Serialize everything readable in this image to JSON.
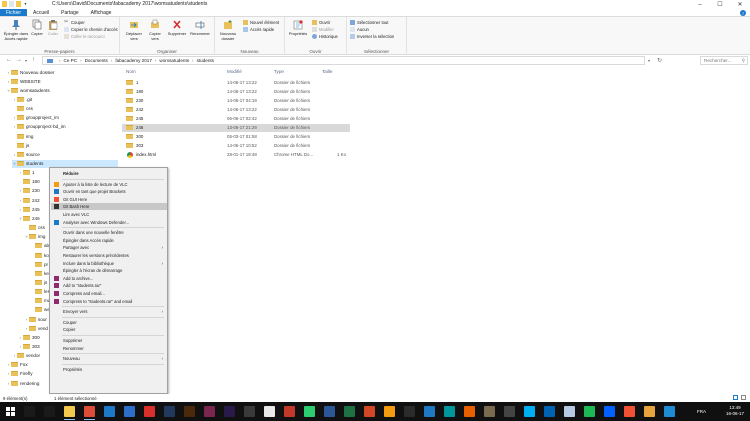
{
  "window": {
    "title": "C:\\Users\\David\\Documents\\fabacademy 2017\\womsatudents\\students",
    "controls": [
      "–",
      "☐",
      "✕"
    ]
  },
  "ribbon": {
    "tabs": [
      "Fichier",
      "Accueil",
      "Partage",
      "Affichage"
    ],
    "groups": {
      "clipboard": {
        "label": "Presse-papiers",
        "pin": "Épingler dans Accès rapide",
        "copy": "Copier",
        "paste": "Coller",
        "cut": "Couper",
        "copy_path": "Copier le chemin d'accès",
        "paste_shortcut": "Coller le raccourci"
      },
      "organize": {
        "label": "Organiser",
        "move": "Déplacer vers",
        "copy_to": "Copier vers",
        "delete": "Supprimer",
        "rename": "Renommer"
      },
      "new": {
        "label": "Nouveau",
        "new_folder": "Nouveau dossier",
        "new_item": "Nouvel élément",
        "easy_access": "Accès rapide"
      },
      "open": {
        "label": "Ouvrir",
        "properties": "Propriétés",
        "open": "Ouvrir",
        "edit": "Modifier",
        "history": "Historique"
      },
      "select": {
        "label": "Sélectionner",
        "select_all": "Sélectionner tout",
        "select_none": "Aucun",
        "invert": "Inverser la sélection"
      }
    }
  },
  "address": {
    "crumbs": [
      "Ce PC",
      "Documents",
      "fabacademy 2017",
      "womsatudents",
      "students"
    ],
    "search_placeholder": "Rechercher..."
  },
  "nav": [
    {
      "label": "Nouveau dossier",
      "depth": 1,
      "chev": ">"
    },
    {
      "label": "WEBSITE",
      "depth": 1,
      "chev": ">"
    },
    {
      "label": "womsatudents",
      "depth": 1,
      "chev": "v"
    },
    {
      "label": ".git",
      "depth": 2,
      "chev": ">"
    },
    {
      "label": "css",
      "depth": 2,
      "chev": ""
    },
    {
      "label": "groupproject_im",
      "depth": 2,
      "chev": ">"
    },
    {
      "label": "groupproject-bd_im",
      "depth": 2,
      "chev": ">"
    },
    {
      "label": "img",
      "depth": 2,
      "chev": ""
    },
    {
      "label": "js",
      "depth": 2,
      "chev": ""
    },
    {
      "label": "source",
      "depth": 2,
      "chev": ">"
    },
    {
      "label": "students",
      "depth": 2,
      "chev": "v",
      "selected": true
    },
    {
      "label": "1",
      "depth": 3,
      "chev": ">"
    },
    {
      "label": "180",
      "depth": 3,
      "chev": ""
    },
    {
      "label": "230",
      "depth": 3,
      "chev": ">"
    },
    {
      "label": "242",
      "depth": 3,
      "chev": ">"
    },
    {
      "label": "245",
      "depth": 3,
      "chev": ">"
    },
    {
      "label": "246",
      "depth": 3,
      "chev": "v"
    },
    {
      "label": "css",
      "depth": 4,
      "chev": ""
    },
    {
      "label": "img",
      "depth": 4,
      "chev": "v"
    },
    {
      "label": "ab",
      "depth": 5,
      "chev": ""
    },
    {
      "label": "ko",
      "depth": 5,
      "chev": ""
    },
    {
      "label": "pr",
      "depth": 5,
      "chev": ""
    },
    {
      "label": "ke",
      "depth": 5,
      "chev": ""
    },
    {
      "label": "js",
      "depth": 5,
      "chev": ""
    },
    {
      "label": "les",
      "depth": 5,
      "chev": ""
    },
    {
      "label": "mai",
      "depth": 5,
      "chev": ""
    },
    {
      "label": "wee",
      "depth": 5,
      "chev": ""
    },
    {
      "label": "sour",
      "depth": 4,
      "chev": ">"
    },
    {
      "label": "vend",
      "depth": 4,
      "chev": ">"
    },
    {
      "label": "300",
      "depth": 3,
      "chev": ">"
    },
    {
      "label": "303",
      "depth": 3,
      "chev": ">"
    },
    {
      "label": "vendor",
      "depth": 2,
      "chev": ">"
    },
    {
      "label": "Fox",
      "depth": 1,
      "chev": ">"
    },
    {
      "label": "Firefly",
      "depth": 1,
      "chev": ">"
    },
    {
      "label": "rendering",
      "depth": 1,
      "chev": ">"
    }
  ],
  "columns": {
    "name": "Nom",
    "modified": "Modifié",
    "type": "Type",
    "size": "Taille"
  },
  "files": [
    {
      "name": "1",
      "modified": "14-06-17 13:22",
      "type": "Dossier de fichiers",
      "size": "",
      "kind": "folder"
    },
    {
      "name": "180",
      "modified": "14-06-17 13:22",
      "type": "Dossier de fichiers",
      "size": "",
      "kind": "folder"
    },
    {
      "name": "230",
      "modified": "14-06-17 04:19",
      "type": "Dossier de fichiers",
      "size": "",
      "kind": "folder"
    },
    {
      "name": "242",
      "modified": "14-06-17 13:22",
      "type": "Dossier de fichiers",
      "size": "",
      "kind": "folder"
    },
    {
      "name": "245",
      "modified": "06-06-17 02:42",
      "type": "Dossier de fichiers",
      "size": "",
      "kind": "folder"
    },
    {
      "name": "246",
      "modified": "13-06-17 21:29",
      "type": "Dossier de fichiers",
      "size": "",
      "kind": "folder",
      "highlight": true
    },
    {
      "name": "300",
      "modified": "05-03-17 01:58",
      "type": "Dossier de fichiers",
      "size": "",
      "kind": "folder"
    },
    {
      "name": "303",
      "modified": "14-06-17 10:52",
      "type": "Dossier de fichiers",
      "size": "",
      "kind": "folder"
    },
    {
      "name": "index.html",
      "modified": "28-01-17 18:48",
      "type": "Chrome HTML Do...",
      "size": "1 Ko",
      "kind": "html"
    }
  ],
  "context_menu": [
    {
      "label": "Réduire",
      "bold": true
    },
    {
      "sep": true
    },
    {
      "label": "Ajouter à la liste de lecture de VLC",
      "icon": "vlc-icon"
    },
    {
      "label": "Ouvrir en tant que projet Brackets",
      "icon": "brackets-icon"
    },
    {
      "label": "Git GUI Here",
      "icon": "git-gui-icon"
    },
    {
      "label": "Git Bash Here",
      "icon": "git-bash-icon",
      "hover": true
    },
    {
      "label": "Lire avec VLC",
      "icon": ""
    },
    {
      "label": "Analyser avec Windows Defender...",
      "icon": "defender-icon"
    },
    {
      "sep": true
    },
    {
      "label": "Ouvrir dans une nouvelle fenêtre"
    },
    {
      "label": "Épingler dans Accès rapide"
    },
    {
      "label": "Partager avec",
      "sub": true
    },
    {
      "label": "Restaurer les versions précédentes"
    },
    {
      "label": "Inclure dans la bibliothèque",
      "sub": true
    },
    {
      "label": "Épingler à l'écran de démarrage"
    },
    {
      "label": "Add to archive...",
      "icon": "winrar-icon"
    },
    {
      "label": "Add to \"students.rar\"",
      "icon": "winrar-icon"
    },
    {
      "label": "Compress and email...",
      "icon": "winrar-icon"
    },
    {
      "label": "Compress to \"students.rar\" and email",
      "icon": "winrar-icon"
    },
    {
      "sep": true
    },
    {
      "label": "Envoyer vers",
      "sub": true
    },
    {
      "sep": true
    },
    {
      "label": "Couper"
    },
    {
      "label": "Copier"
    },
    {
      "sep": true
    },
    {
      "label": "Supprimer"
    },
    {
      "label": "Renommer"
    },
    {
      "sep": true
    },
    {
      "label": "Nouveau",
      "sub": true
    },
    {
      "sep": true
    },
    {
      "label": "Propriétés"
    }
  ],
  "status": {
    "count": "9 élément(s)",
    "selected": "1 élément sélectionné"
  },
  "taskbar": {
    "lang": "FRA",
    "time": "13:49",
    "date": "16-06-17",
    "apps": [
      {
        "name": "search-icon",
        "color": "#1a1a1a"
      },
      {
        "name": "task-view-icon",
        "color": "#1a1a1a"
      },
      {
        "name": "file-explorer-icon",
        "color": "#f2c94c",
        "active": true
      },
      {
        "name": "chrome-icon",
        "color": "#dd4b39",
        "active": true
      },
      {
        "name": "edge-icon",
        "color": "#1e78c8"
      },
      {
        "name": "store-icon",
        "color": "#2d6ec8"
      },
      {
        "name": "acrobat-icon",
        "color": "#d9302c"
      },
      {
        "name": "photoshop-icon",
        "color": "#21395a"
      },
      {
        "name": "illustrator-icon",
        "color": "#4a2a0a"
      },
      {
        "name": "indesign-icon",
        "color": "#7a2750"
      },
      {
        "name": "premiere-icon",
        "color": "#2a1a4a"
      },
      {
        "name": "rhino-icon",
        "color": "#3a3a3a"
      },
      {
        "name": "inkscape-icon",
        "color": "#e8e8e8"
      },
      {
        "name": "sketchup-icon",
        "color": "#c0392b"
      },
      {
        "name": "cura-icon",
        "color": "#2ecc71"
      },
      {
        "name": "word-icon",
        "color": "#2b5797"
      },
      {
        "name": "excel-icon",
        "color": "#1e7145"
      },
      {
        "name": "powerpoint-icon",
        "color": "#d24726"
      },
      {
        "name": "vlc-icon",
        "color": "#f39c12"
      },
      {
        "name": "terminal-icon",
        "color": "#2b2b2b"
      },
      {
        "name": "brackets-icon",
        "color": "#1f78c1"
      },
      {
        "name": "arduino-icon",
        "color": "#00979c"
      },
      {
        "name": "firefox-icon",
        "color": "#e66000"
      },
      {
        "name": "gimp-icon",
        "color": "#7a6a50"
      },
      {
        "name": "calculator-icon",
        "color": "#444"
      },
      {
        "name": "skype-icon",
        "color": "#00aff0"
      },
      {
        "name": "mail-icon",
        "color": "#0063b1"
      },
      {
        "name": "notepad-icon",
        "color": "#b7c9e2"
      },
      {
        "name": "spotify-icon",
        "color": "#1db954"
      },
      {
        "name": "dropbox-icon",
        "color": "#0061fe"
      },
      {
        "name": "git-icon",
        "color": "#f05033"
      },
      {
        "name": "paint-icon",
        "color": "#e7a33e"
      },
      {
        "name": "maps-icon",
        "color": "#1e8bd2"
      }
    ]
  },
  "colors": {
    "accent": "#1979ca",
    "selection": "#cce8ff",
    "hover": "#d9d9d9",
    "folder": "#e8c15b"
  }
}
